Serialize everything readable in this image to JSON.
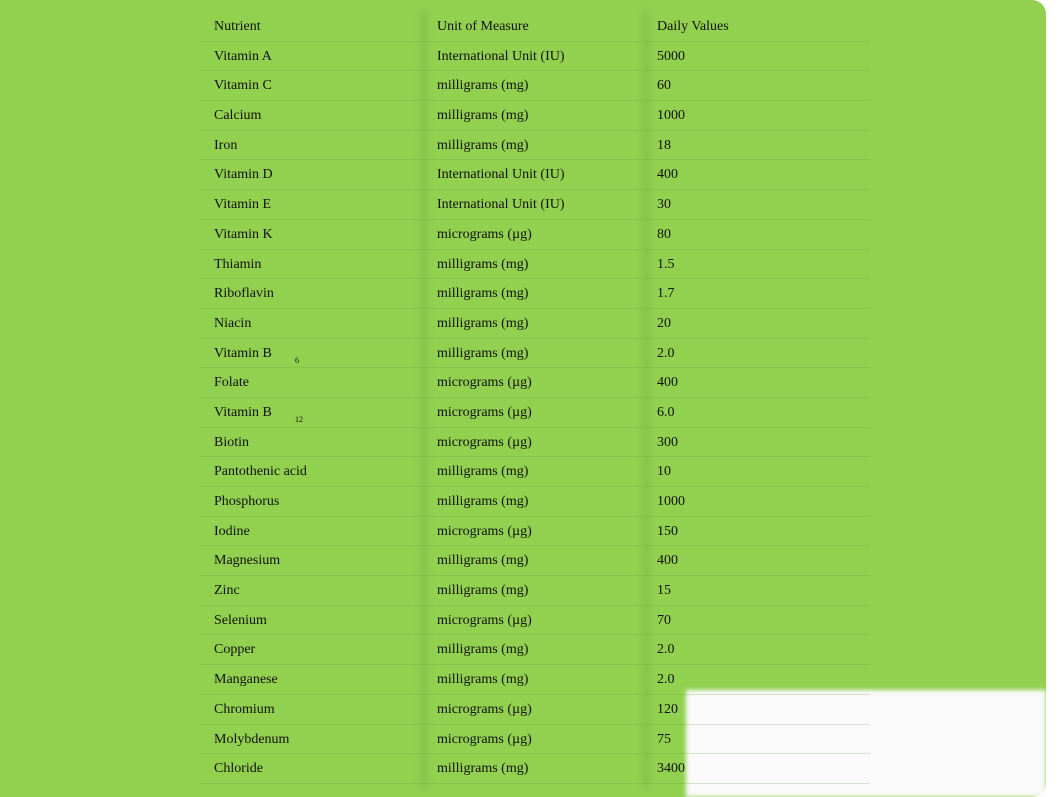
{
  "table": {
    "headers": [
      "Nutrient",
      "Unit of Measure",
      "Daily Values"
    ],
    "rows": [
      {
        "nutrient": "Vitamin A",
        "sub": "",
        "unit": "International Unit (IU)",
        "value": "5000"
      },
      {
        "nutrient": "Vitamin C",
        "sub": "",
        "unit": "milligrams (mg)",
        "value": "60"
      },
      {
        "nutrient": "Calcium",
        "sub": "",
        "unit": "milligrams (mg)",
        "value": "1000"
      },
      {
        "nutrient": "Iron",
        "sub": "",
        "unit": "milligrams (mg)",
        "value": "18"
      },
      {
        "nutrient": "Vitamin D",
        "sub": "",
        "unit": "International Unit (IU)",
        "value": "400"
      },
      {
        "nutrient": "Vitamin E",
        "sub": "",
        "unit": "International Unit (IU)",
        "value": "30"
      },
      {
        "nutrient": "Vitamin K",
        "sub": "",
        "unit": "micrograms (µg)",
        "value": "80"
      },
      {
        "nutrient": "Thiamin",
        "sub": "",
        "unit": "milligrams (mg)",
        "value": "1.5"
      },
      {
        "nutrient": "Riboflavin",
        "sub": "",
        "unit": "milligrams (mg)",
        "value": "1.7"
      },
      {
        "nutrient": "Niacin",
        "sub": "",
        "unit": "milligrams (mg)",
        "value": "20"
      },
      {
        "nutrient": "Vitamin B",
        "sub": "6",
        "unit": "milligrams (mg)",
        "value": "2.0"
      },
      {
        "nutrient": "Folate",
        "sub": "",
        "unit": "micrograms (µg)",
        "value": "400"
      },
      {
        "nutrient": "Vitamin B",
        "sub": "12",
        "unit": "micrograms (µg)",
        "value": "6.0"
      },
      {
        "nutrient": "Biotin",
        "sub": "",
        "unit": "micrograms (µg)",
        "value": "300"
      },
      {
        "nutrient": "Pantothenic acid",
        "sub": "",
        "unit": "milligrams (mg)",
        "value": "10"
      },
      {
        "nutrient": "Phosphorus",
        "sub": "",
        "unit": "milligrams (mg)",
        "value": "1000"
      },
      {
        "nutrient": "Iodine",
        "sub": "",
        "unit": "micrograms (µg)",
        "value": "150"
      },
      {
        "nutrient": "Magnesium",
        "sub": "",
        "unit": "milligrams (mg)",
        "value": "400"
      },
      {
        "nutrient": "Zinc",
        "sub": "",
        "unit": "milligrams (mg)",
        "value": "15"
      },
      {
        "nutrient": "Selenium",
        "sub": "",
        "unit": "micrograms (µg)",
        "value": "70"
      },
      {
        "nutrient": "Copper",
        "sub": "",
        "unit": "milligrams (mg)",
        "value": "2.0"
      },
      {
        "nutrient": "Manganese",
        "sub": "",
        "unit": "milligrams (mg)",
        "value": "2.0"
      },
      {
        "nutrient": "Chromium",
        "sub": "",
        "unit": "micrograms (µg)",
        "value": "120"
      },
      {
        "nutrient": "Molybdenum",
        "sub": "",
        "unit": "micrograms (µg)",
        "value": "75"
      },
      {
        "nutrient": "Chloride",
        "sub": "",
        "unit": "milligrams (mg)",
        "value": "3400"
      }
    ]
  },
  "colors": {
    "background": "#92d050",
    "text": "#111111"
  }
}
